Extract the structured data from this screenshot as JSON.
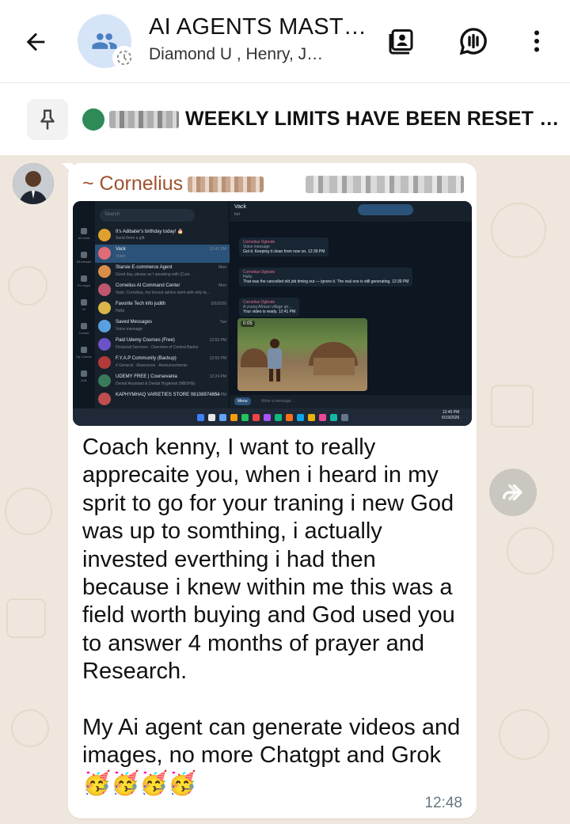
{
  "header": {
    "title": "AI AGENTS MAST…",
    "subtitle": "Diamond U     , Henry, J…"
  },
  "pinned": {
    "text": "WEEKLY LIMITS HAVE BEEN RESET …"
  },
  "message": {
    "sender": "~ Cornelius",
    "time": "12:48",
    "text": "Coach kenny, I want to really apprecaite you, when i heard in my sprit to go for your traning i new God was up to somthing, i actually invested everthing i had then because i knew within me this was a field worth buying and God used you to answer 4 months of prayer and Research.\n\nMy Ai agent can generate videos and images, no more Chatgpt and Grok 🥳🥳🥳🥳",
    "screenshot": {
      "search_placeholder": "Search",
      "chats": [
        {
          "name": "It's Adibater's birthday today! 🎂",
          "preview": "Send them a gift.",
          "time": "",
          "color": "#e0a030"
        },
        {
          "name": "Vack",
          "preview": "Video",
          "time": "12:41 PM",
          "color": "#e06c75",
          "active": true
        },
        {
          "name": "Starsie E-commerce Agent",
          "preview": "Good day, please as I speaking with [Cust…",
          "time": "Mon",
          "color": "#d98e48"
        },
        {
          "name": "Cornelius AI Command Center",
          "preview": "Vack: Cornelius, my honest advice work with only ta…",
          "time": "Mon",
          "color": "#c2566f"
        },
        {
          "name": "Favorite Tech info judith",
          "preview": "Hello",
          "time": "5/6/2026",
          "color": "#d9b54a"
        },
        {
          "name": "Saved Messages",
          "preview": "Voice message",
          "time": "Tue",
          "color": "#5aa0e0"
        },
        {
          "name": "Paid Udemy Courses (Free)",
          "preview": "Financial Services - Overview of Central Banks",
          "time": "12:55 PM",
          "color": "#6b52c9"
        },
        {
          "name": "F.Y.A.P Community (Backup)",
          "preview": "# General · Resources · Announcements",
          "time": "12:50 PM",
          "color": "#b33a3a"
        },
        {
          "name": "UDEMY FREE | Coursevania",
          "preview": "Dental Assistant & Dental Hygienist (NBDHE)",
          "time": "12:24 PM",
          "color": "#3a7a5a"
        },
        {
          "name": "KAPHYMHAQ VARIETIES STORE 08108974654",
          "preview": "",
          "time": "12:21 PM",
          "color": "#c04d4d"
        }
      ],
      "sidebar_labels": [
        "All chats",
        "Wholesale",
        "Pro Apps",
        "AI",
        "Course",
        "My Course",
        "Edit"
      ],
      "convo_title": "Vack",
      "convo_status": "bot",
      "bubbles": [
        {
          "author": "Cornelius Ogbodo",
          "quote": "Voice message",
          "text": "Got it. Keeping it clean from now on.",
          "time": "12:39 PM"
        },
        {
          "author": "Cornelius Ogbodo",
          "quote": "Hello",
          "text": "That was the cancelled old job timing out — ignore it. The real one is still generating.",
          "time": "12:39 PM"
        },
        {
          "author": "Cornelius Ogbodo",
          "quote": "A young African village gir…",
          "text": "Your video is ready.",
          "time": "12:41 PM"
        }
      ],
      "video_duration": "0:05",
      "compose_placeholder": "Write a message…",
      "menu_label": "Menu",
      "clock_time": "12:45 PM",
      "clock_date": "6/19/2026"
    }
  },
  "colors": {
    "sender_name": "#a0522d",
    "wallpaper": "#efe7dd",
    "bubble": "#ffffff"
  },
  "icons": {
    "back": "arrow-left-icon",
    "group_avatar": "group-icon",
    "contact_card": "contact-card-icon",
    "voice_chat": "voice-chat-icon",
    "menu": "more-vertical-icon",
    "pin": "pin-icon",
    "forward": "forward-icon"
  }
}
